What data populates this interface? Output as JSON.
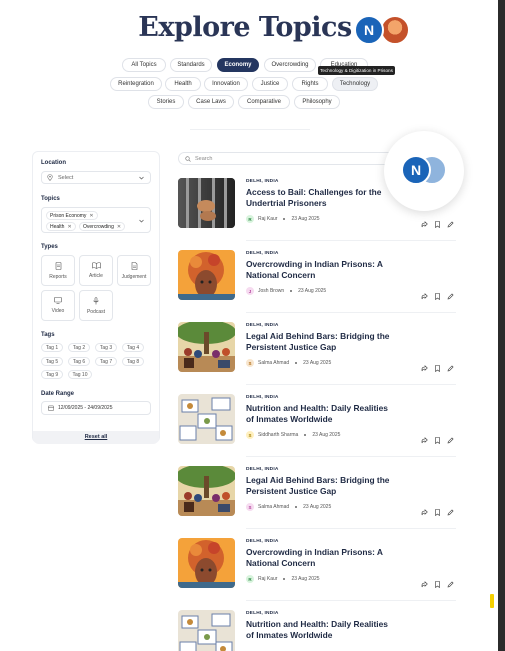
{
  "page_title": "Explore Topics",
  "header_avatars": [
    "N",
    ""
  ],
  "topics_row1": [
    "All Topics",
    "Standards",
    "Economy",
    "Overcrowding",
    "Education"
  ],
  "topics_row2": [
    "Reintegration",
    "Health",
    "Innovation",
    "Justice",
    "Rights",
    "Technology"
  ],
  "topics_row3": [
    "Stories",
    "Case Laws",
    "Comparative",
    "Philosophy"
  ],
  "active_topic": "Economy",
  "tooltip": "Technology & Digitization in Prisons",
  "filters": {
    "location_label": "Location",
    "location_placeholder": "Select",
    "topics_label": "Topics",
    "selected_topics": [
      "Prison Economy",
      "Health",
      "Overcrowding"
    ],
    "types_label": "Types",
    "types": [
      {
        "label": "Reports",
        "icon": "document-icon"
      },
      {
        "label": "Article",
        "icon": "book-open-icon"
      },
      {
        "label": "Judgement",
        "icon": "file-text-icon"
      },
      {
        "label": "Video",
        "icon": "monitor-icon"
      },
      {
        "label": "Podcast",
        "icon": "microphone-icon"
      }
    ],
    "tags_label": "Tags",
    "tags": [
      "Tag 1",
      "Tag 2",
      "Tag 3",
      "Tag 4",
      "Tag 5",
      "Tag 6",
      "Tag 7",
      "Tag 8",
      "Tag 9",
      "Tag 10"
    ],
    "date_label": "Date Range",
    "date_value": "12/09/2025 - 24/09/2025",
    "reset_label": "Reset all"
  },
  "search_placeholder": "Search",
  "floating_avatar": "N",
  "articles": [
    {
      "location": "DELHI, INDIA",
      "title": "Access to Bail: Challenges for the Undertrial Prisoners",
      "author": "Raj Kaur",
      "initial": "R",
      "date": "23 Aug 2025",
      "thumb": "bars"
    },
    {
      "location": "DELHI, INDIA",
      "title": "Overcrowding in Indian Prisons: A National Concern",
      "author": "Josh Brown",
      "initial": "J",
      "date": "23 Aug 2025",
      "thumb": "head"
    },
    {
      "location": "DELHI, INDIA",
      "title": "Legal Aid Behind Bars: Bridging the Persistent Justice Gap",
      "author": "Salma Ahmad",
      "initial": "S",
      "date": "23 Aug 2025",
      "thumb": "tree"
    },
    {
      "location": "DELHI, INDIA",
      "title": "Nutrition and Health: Daily Realities of Inmates Worldwide",
      "author": "Siddharth Sharma",
      "initial": "S",
      "date": "23 Aug 2025",
      "thumb": "food"
    },
    {
      "location": "DELHI, INDIA",
      "title": "Legal Aid Behind Bars: Bridging the Persistent Justice Gap",
      "author": "Salma Ahmad",
      "initial": "S",
      "date": "23 Aug 2025",
      "thumb": "tree"
    },
    {
      "location": "DELHI, INDIA",
      "title": "Overcrowding in Indian Prisons: A National Concern",
      "author": "Raj Kaur",
      "initial": "R",
      "date": "23 Aug 2025",
      "thumb": "head"
    },
    {
      "location": "DELHI, INDIA",
      "title": "Nutrition and Health: Daily Realities of Inmates Worldwide",
      "author": "",
      "initial": "",
      "date": "",
      "thumb": "food"
    }
  ],
  "colors": {
    "accent": "#243660",
    "brand_blue": "#1a64b8",
    "highlight": "#f5d000"
  }
}
